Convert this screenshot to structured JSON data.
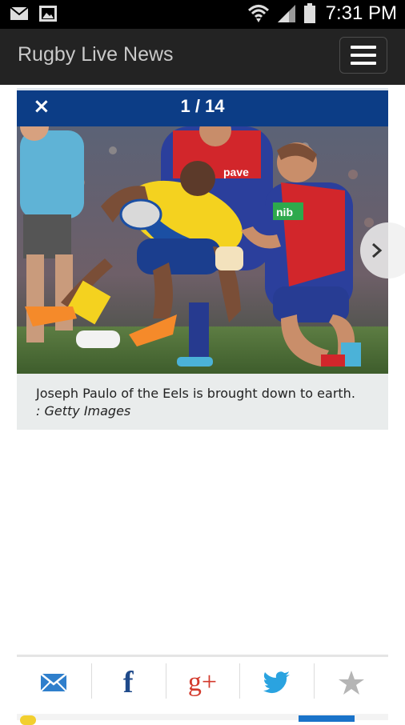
{
  "status_bar": {
    "time": "7:31 PM",
    "icons": [
      "mail-icon",
      "image-icon",
      "wifi-icon",
      "signal-icon",
      "battery-icon"
    ]
  },
  "app": {
    "title": "Rugby Live News",
    "menu_icon": "hamburger-menu-icon"
  },
  "gallery": {
    "close_label": "×",
    "counter": "1 / 14",
    "caption": "Joseph Paulo of the Eels is brought down to earth.",
    "credit": ": Getty Images",
    "next_icon": "chevron-right-icon",
    "colors": {
      "bar": "#0c3d86",
      "caption_bg": "#e9ecec"
    }
  },
  "share": {
    "items": [
      {
        "name": "email",
        "icon": "email-icon",
        "color": "#2f7fcc"
      },
      {
        "name": "facebook",
        "icon": "facebook-icon",
        "label": "f",
        "color": "#1f4a8a"
      },
      {
        "name": "google-plus",
        "icon": "google-plus-icon",
        "label": "g+",
        "color": "#d33a2c"
      },
      {
        "name": "twitter",
        "icon": "twitter-icon",
        "color": "#2aa3e0"
      },
      {
        "name": "favorite",
        "icon": "star-icon",
        "color": "#b5b5b5"
      }
    ]
  }
}
